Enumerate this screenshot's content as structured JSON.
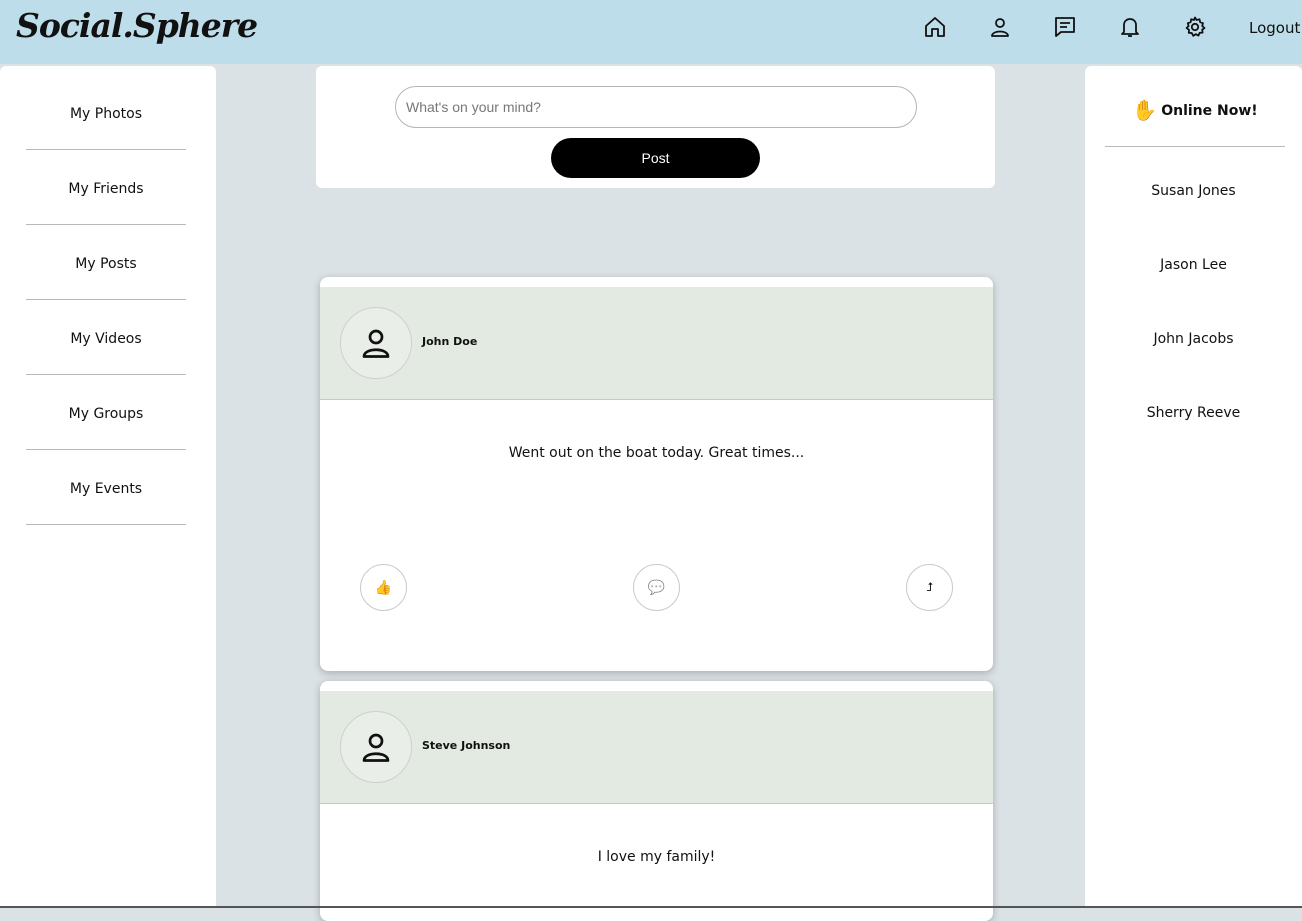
{
  "header": {
    "logo": "Social.Sphere",
    "nav_icons": [
      "home-icon",
      "profile-icon",
      "messages-icon",
      "notifications-icon",
      "settings-icon"
    ],
    "logout_label": "Logout"
  },
  "sidebar": {
    "items": [
      {
        "label": "My Photos"
      },
      {
        "label": "My Friends"
      },
      {
        "label": "My Posts"
      },
      {
        "label": "My Videos"
      },
      {
        "label": "My Groups"
      },
      {
        "label": "My Events"
      }
    ]
  },
  "composer": {
    "placeholder": "What's on your mind?",
    "post_label": "Post"
  },
  "posts": [
    {
      "author": "John Doe",
      "text": "Went out on the boat today. Great times..."
    },
    {
      "author": "Steve Johnson",
      "text": "I love my family!"
    }
  ],
  "actions": {
    "like_icon": "👍",
    "comment_icon": "💬",
    "share_icon": "⮥"
  },
  "online": {
    "icon": "✋",
    "title": "Online Now!",
    "users": [
      "Susan Jones",
      "Jason Lee",
      "John Jacobs",
      "Sherry Reeve"
    ]
  },
  "colors": {
    "header_bg": "#bcdde9",
    "page_bg": "#dbe2e6",
    "post_header_bg": "#e2eae1",
    "accent": "#000000"
  }
}
